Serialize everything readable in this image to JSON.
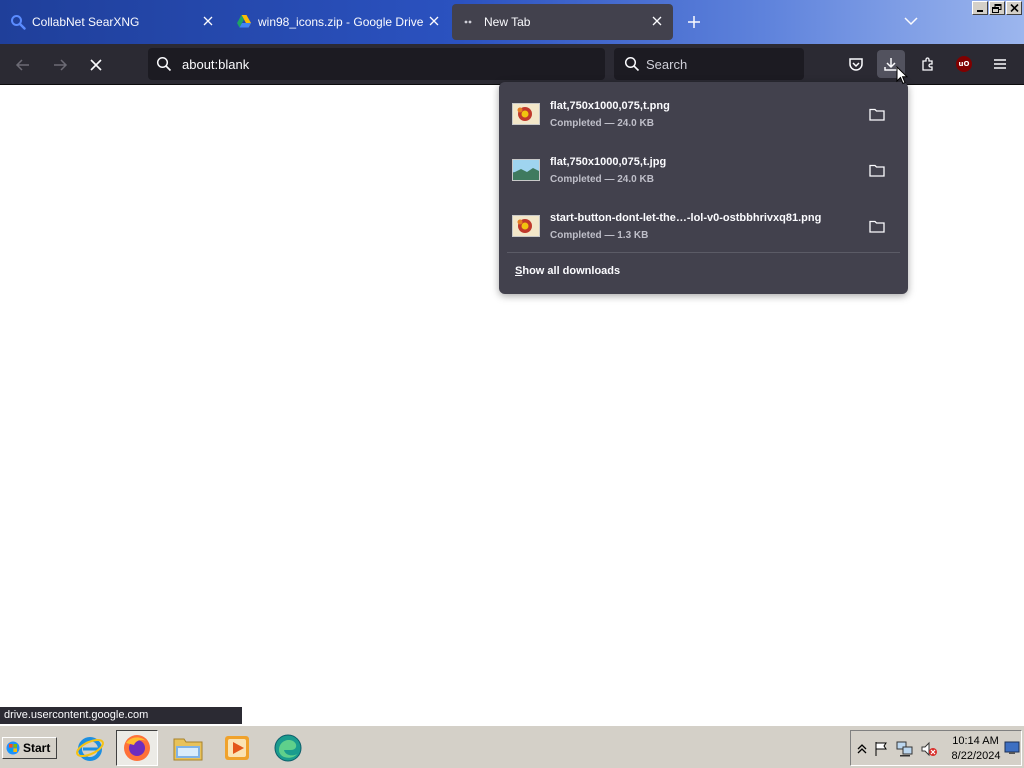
{
  "colors": {
    "accent": "#42414d",
    "toolbar": "#2b2a33",
    "taskbar": "#d4d0c8"
  },
  "tabs": [
    {
      "title": "CollabNet SearXNG",
      "icon": "searxng-search-icon",
      "active": false
    },
    {
      "title": "win98_icons.zip - Google Drive",
      "icon": "google-drive-icon",
      "active": false
    },
    {
      "title": "New Tab",
      "icon": "loading-icon",
      "active": true
    }
  ],
  "urlbar": {
    "value": "about:blank"
  },
  "searchbar": {
    "placeholder": "Search"
  },
  "toolbar": {
    "ublock_label": "uO"
  },
  "downloads": {
    "items": [
      {
        "name": "flat,750x1000,075,t.png",
        "status": "Completed — 24.0 KB",
        "icon": "image-thumbnail-icon"
      },
      {
        "name": "flat,750x1000,075,t.jpg",
        "status": "Completed — 24.0 KB",
        "icon": "image-thumbnail-icon"
      },
      {
        "name": "start-button-dont-let-the…-lol-v0-ostbbhrivxq81.png",
        "status": "Completed — 1.3 KB",
        "icon": "image-thumbnail-icon"
      }
    ],
    "show_all_accel": "S",
    "show_all_rest": "how all downloads"
  },
  "status_link": "drive.usercontent.google.com",
  "taskbar": {
    "start_label": "Start",
    "clock_time": "10:14 AM",
    "clock_date": "8/22/2024"
  }
}
